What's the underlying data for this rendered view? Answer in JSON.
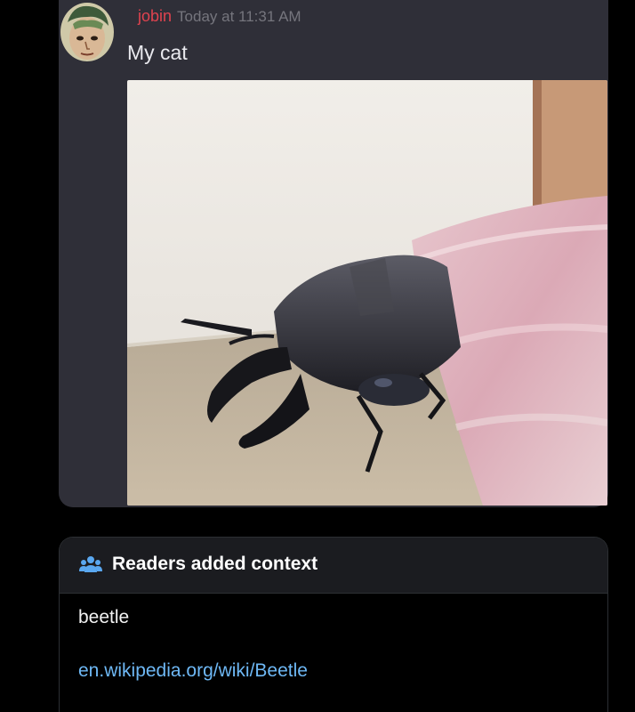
{
  "message": {
    "username": "jobin",
    "timestamp": "Today at 11:31 AM",
    "text": "My cat",
    "avatar_icon": "avatar-portrait-icon"
  },
  "attachment": {
    "kind": "photo",
    "subject": "stag-beetle-under-blanket"
  },
  "context_note": {
    "icon": "people-icon",
    "title": "Readers added context",
    "body": "beetle",
    "link": "en.wikipedia.org/wiki/Beetle"
  },
  "colors": {
    "background": "#000000",
    "message_card": "#2f2f38",
    "username": "#e0434f",
    "timestamp": "#75757d",
    "context_header": "#1b1c20",
    "link": "#6eb8f5",
    "icon_accent": "#5aa8f0"
  }
}
